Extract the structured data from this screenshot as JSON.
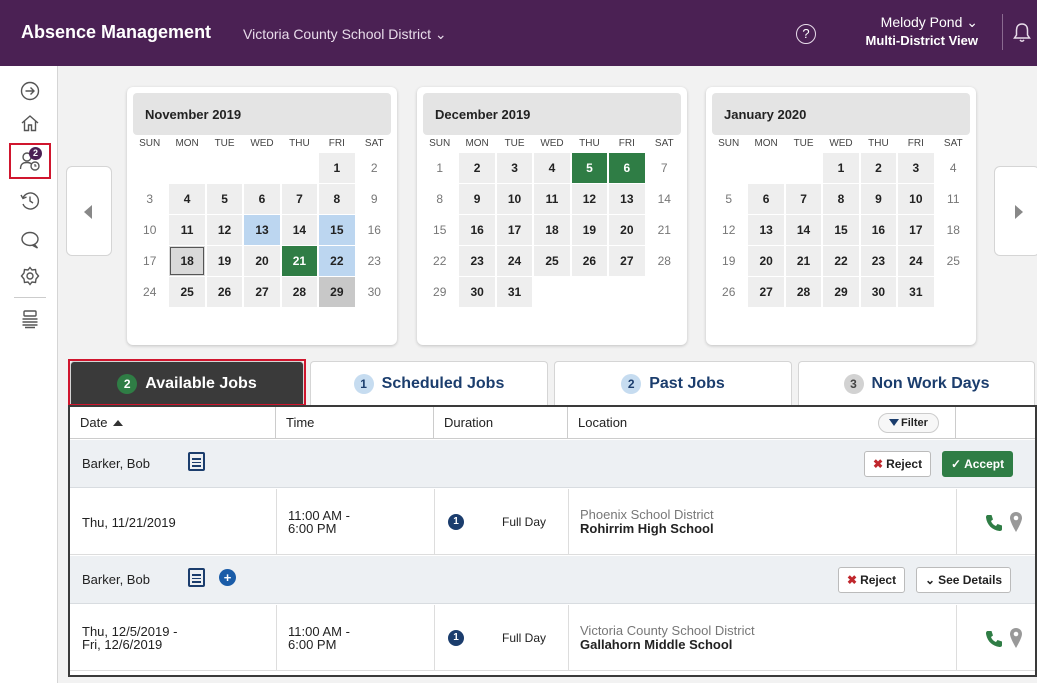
{
  "app": {
    "title": "Absence Management",
    "district": "Victoria County School District ⌄",
    "help": "?",
    "user_name": "Melody Pond ⌄",
    "user_view": "Multi-District View"
  },
  "rail": {
    "badge": "2",
    "icons": [
      "arrow-right-circle-icon",
      "home-icon",
      "users-clock-icon",
      "history-icon",
      "chat-icon",
      "gear-icon",
      "stack-icon"
    ]
  },
  "calendars": [
    {
      "month": "November 2019",
      "dow": [
        "SUN",
        "MON",
        "TUE",
        "WED",
        "THU",
        "FRI",
        "SAT"
      ],
      "days": [
        {
          "t": "",
          "s": "blank"
        },
        {
          "t": "",
          "s": "blank"
        },
        {
          "t": "",
          "s": "blank"
        },
        {
          "t": "",
          "s": "blank"
        },
        {
          "t": "",
          "s": "blank"
        },
        {
          "t": "1",
          "s": "wk"
        },
        {
          "t": "2",
          "s": "we"
        },
        {
          "t": "3",
          "s": "we"
        },
        {
          "t": "4",
          "s": "wk"
        },
        {
          "t": "5",
          "s": "wk"
        },
        {
          "t": "6",
          "s": "wk"
        },
        {
          "t": "7",
          "s": "wk"
        },
        {
          "t": "8",
          "s": "wk"
        },
        {
          "t": "9",
          "s": "we"
        },
        {
          "t": "10",
          "s": "we"
        },
        {
          "t": "11",
          "s": "wk"
        },
        {
          "t": "12",
          "s": "wk"
        },
        {
          "t": "13",
          "s": "blue"
        },
        {
          "t": "14",
          "s": "wk"
        },
        {
          "t": "15",
          "s": "blue"
        },
        {
          "t": "16",
          "s": "we"
        },
        {
          "t": "17",
          "s": "we"
        },
        {
          "t": "18",
          "s": "outlined"
        },
        {
          "t": "19",
          "s": "wk"
        },
        {
          "t": "20",
          "s": "wk"
        },
        {
          "t": "21",
          "s": "green"
        },
        {
          "t": "22",
          "s": "blue"
        },
        {
          "t": "23",
          "s": "we"
        },
        {
          "t": "24",
          "s": "we"
        },
        {
          "t": "25",
          "s": "wk"
        },
        {
          "t": "26",
          "s": "wk"
        },
        {
          "t": "27",
          "s": "wk"
        },
        {
          "t": "28",
          "s": "wk"
        },
        {
          "t": "29",
          "s": "grey"
        },
        {
          "t": "30",
          "s": "we"
        }
      ]
    },
    {
      "month": "December 2019",
      "dow": [
        "SUN",
        "MON",
        "TUE",
        "WED",
        "THU",
        "FRI",
        "SAT"
      ],
      "days": [
        {
          "t": "1",
          "s": "we"
        },
        {
          "t": "2",
          "s": "wk"
        },
        {
          "t": "3",
          "s": "wk"
        },
        {
          "t": "4",
          "s": "wk"
        },
        {
          "t": "5",
          "s": "green"
        },
        {
          "t": "6",
          "s": "green"
        },
        {
          "t": "7",
          "s": "we"
        },
        {
          "t": "8",
          "s": "we"
        },
        {
          "t": "9",
          "s": "wk"
        },
        {
          "t": "10",
          "s": "wk"
        },
        {
          "t": "11",
          "s": "wk"
        },
        {
          "t": "12",
          "s": "wk"
        },
        {
          "t": "13",
          "s": "wk"
        },
        {
          "t": "14",
          "s": "we"
        },
        {
          "t": "15",
          "s": "we"
        },
        {
          "t": "16",
          "s": "wk"
        },
        {
          "t": "17",
          "s": "wk"
        },
        {
          "t": "18",
          "s": "wk"
        },
        {
          "t": "19",
          "s": "wk"
        },
        {
          "t": "20",
          "s": "wk"
        },
        {
          "t": "21",
          "s": "we"
        },
        {
          "t": "22",
          "s": "we"
        },
        {
          "t": "23",
          "s": "wk"
        },
        {
          "t": "24",
          "s": "wk"
        },
        {
          "t": "25",
          "s": "wk"
        },
        {
          "t": "26",
          "s": "wk"
        },
        {
          "t": "27",
          "s": "wk"
        },
        {
          "t": "28",
          "s": "we"
        },
        {
          "t": "29",
          "s": "we"
        },
        {
          "t": "30",
          "s": "wk"
        },
        {
          "t": "31",
          "s": "wk"
        },
        {
          "t": "",
          "s": "blank"
        },
        {
          "t": "",
          "s": "blank"
        },
        {
          "t": "",
          "s": "blank"
        },
        {
          "t": "",
          "s": "blank"
        }
      ]
    },
    {
      "month": "January 2020",
      "dow": [
        "SUN",
        "MON",
        "TUE",
        "WED",
        "THU",
        "FRI",
        "SAT"
      ],
      "days": [
        {
          "t": "",
          "s": "blank"
        },
        {
          "t": "",
          "s": "blank"
        },
        {
          "t": "",
          "s": "blank"
        },
        {
          "t": "1",
          "s": "wk"
        },
        {
          "t": "2",
          "s": "wk"
        },
        {
          "t": "3",
          "s": "wk"
        },
        {
          "t": "4",
          "s": "we"
        },
        {
          "t": "5",
          "s": "we"
        },
        {
          "t": "6",
          "s": "wk"
        },
        {
          "t": "7",
          "s": "wk"
        },
        {
          "t": "8",
          "s": "wk"
        },
        {
          "t": "9",
          "s": "wk"
        },
        {
          "t": "10",
          "s": "wk"
        },
        {
          "t": "11",
          "s": "we"
        },
        {
          "t": "12",
          "s": "we"
        },
        {
          "t": "13",
          "s": "wk"
        },
        {
          "t": "14",
          "s": "wk"
        },
        {
          "t": "15",
          "s": "wk"
        },
        {
          "t": "16",
          "s": "wk"
        },
        {
          "t": "17",
          "s": "wk"
        },
        {
          "t": "18",
          "s": "we"
        },
        {
          "t": "19",
          "s": "we"
        },
        {
          "t": "20",
          "s": "wk"
        },
        {
          "t": "21",
          "s": "wk"
        },
        {
          "t": "22",
          "s": "wk"
        },
        {
          "t": "23",
          "s": "wk"
        },
        {
          "t": "24",
          "s": "wk"
        },
        {
          "t": "25",
          "s": "we"
        },
        {
          "t": "26",
          "s": "we"
        },
        {
          "t": "27",
          "s": "wk"
        },
        {
          "t": "28",
          "s": "wk"
        },
        {
          "t": "29",
          "s": "wk"
        },
        {
          "t": "30",
          "s": "wk"
        },
        {
          "t": "31",
          "s": "wk"
        },
        {
          "t": "",
          "s": "blank"
        }
      ]
    }
  ],
  "tabs": [
    {
      "count": "2",
      "label": "Available Jobs"
    },
    {
      "count": "1",
      "label": "Scheduled Jobs"
    },
    {
      "count": "2",
      "label": "Past Jobs"
    },
    {
      "count": "3",
      "label": "Non Work Days"
    }
  ],
  "table": {
    "headers": {
      "date": "Date",
      "time": "Time",
      "duration": "Duration",
      "location": "Location"
    },
    "filter": "Filter",
    "groups": [
      {
        "employee": "Barker, Bob",
        "reject": "Reject",
        "action": "Accept",
        "date": "Thu, 11/21/2019",
        "time1": "11:00 AM -",
        "time2": "6:00 PM",
        "duration": "Full Day",
        "district": "Phoenix School District",
        "school": "Rohirrim High School"
      },
      {
        "employee": "Barker, Bob",
        "reject": "Reject",
        "action": "See Details",
        "date1": "Thu, 12/5/2019 -",
        "date2": "Fri, 12/6/2019",
        "time1": "11:00 AM -",
        "time2": "6:00 PM",
        "duration": "Full Day",
        "district": "Victoria County School District",
        "school": "Gallahorn Middle School"
      }
    ]
  },
  "colors": {
    "brand": "#4b2154",
    "accent_green": "#2f7d45",
    "navy": "#1b3d6d",
    "highlight": "#d0162e"
  }
}
